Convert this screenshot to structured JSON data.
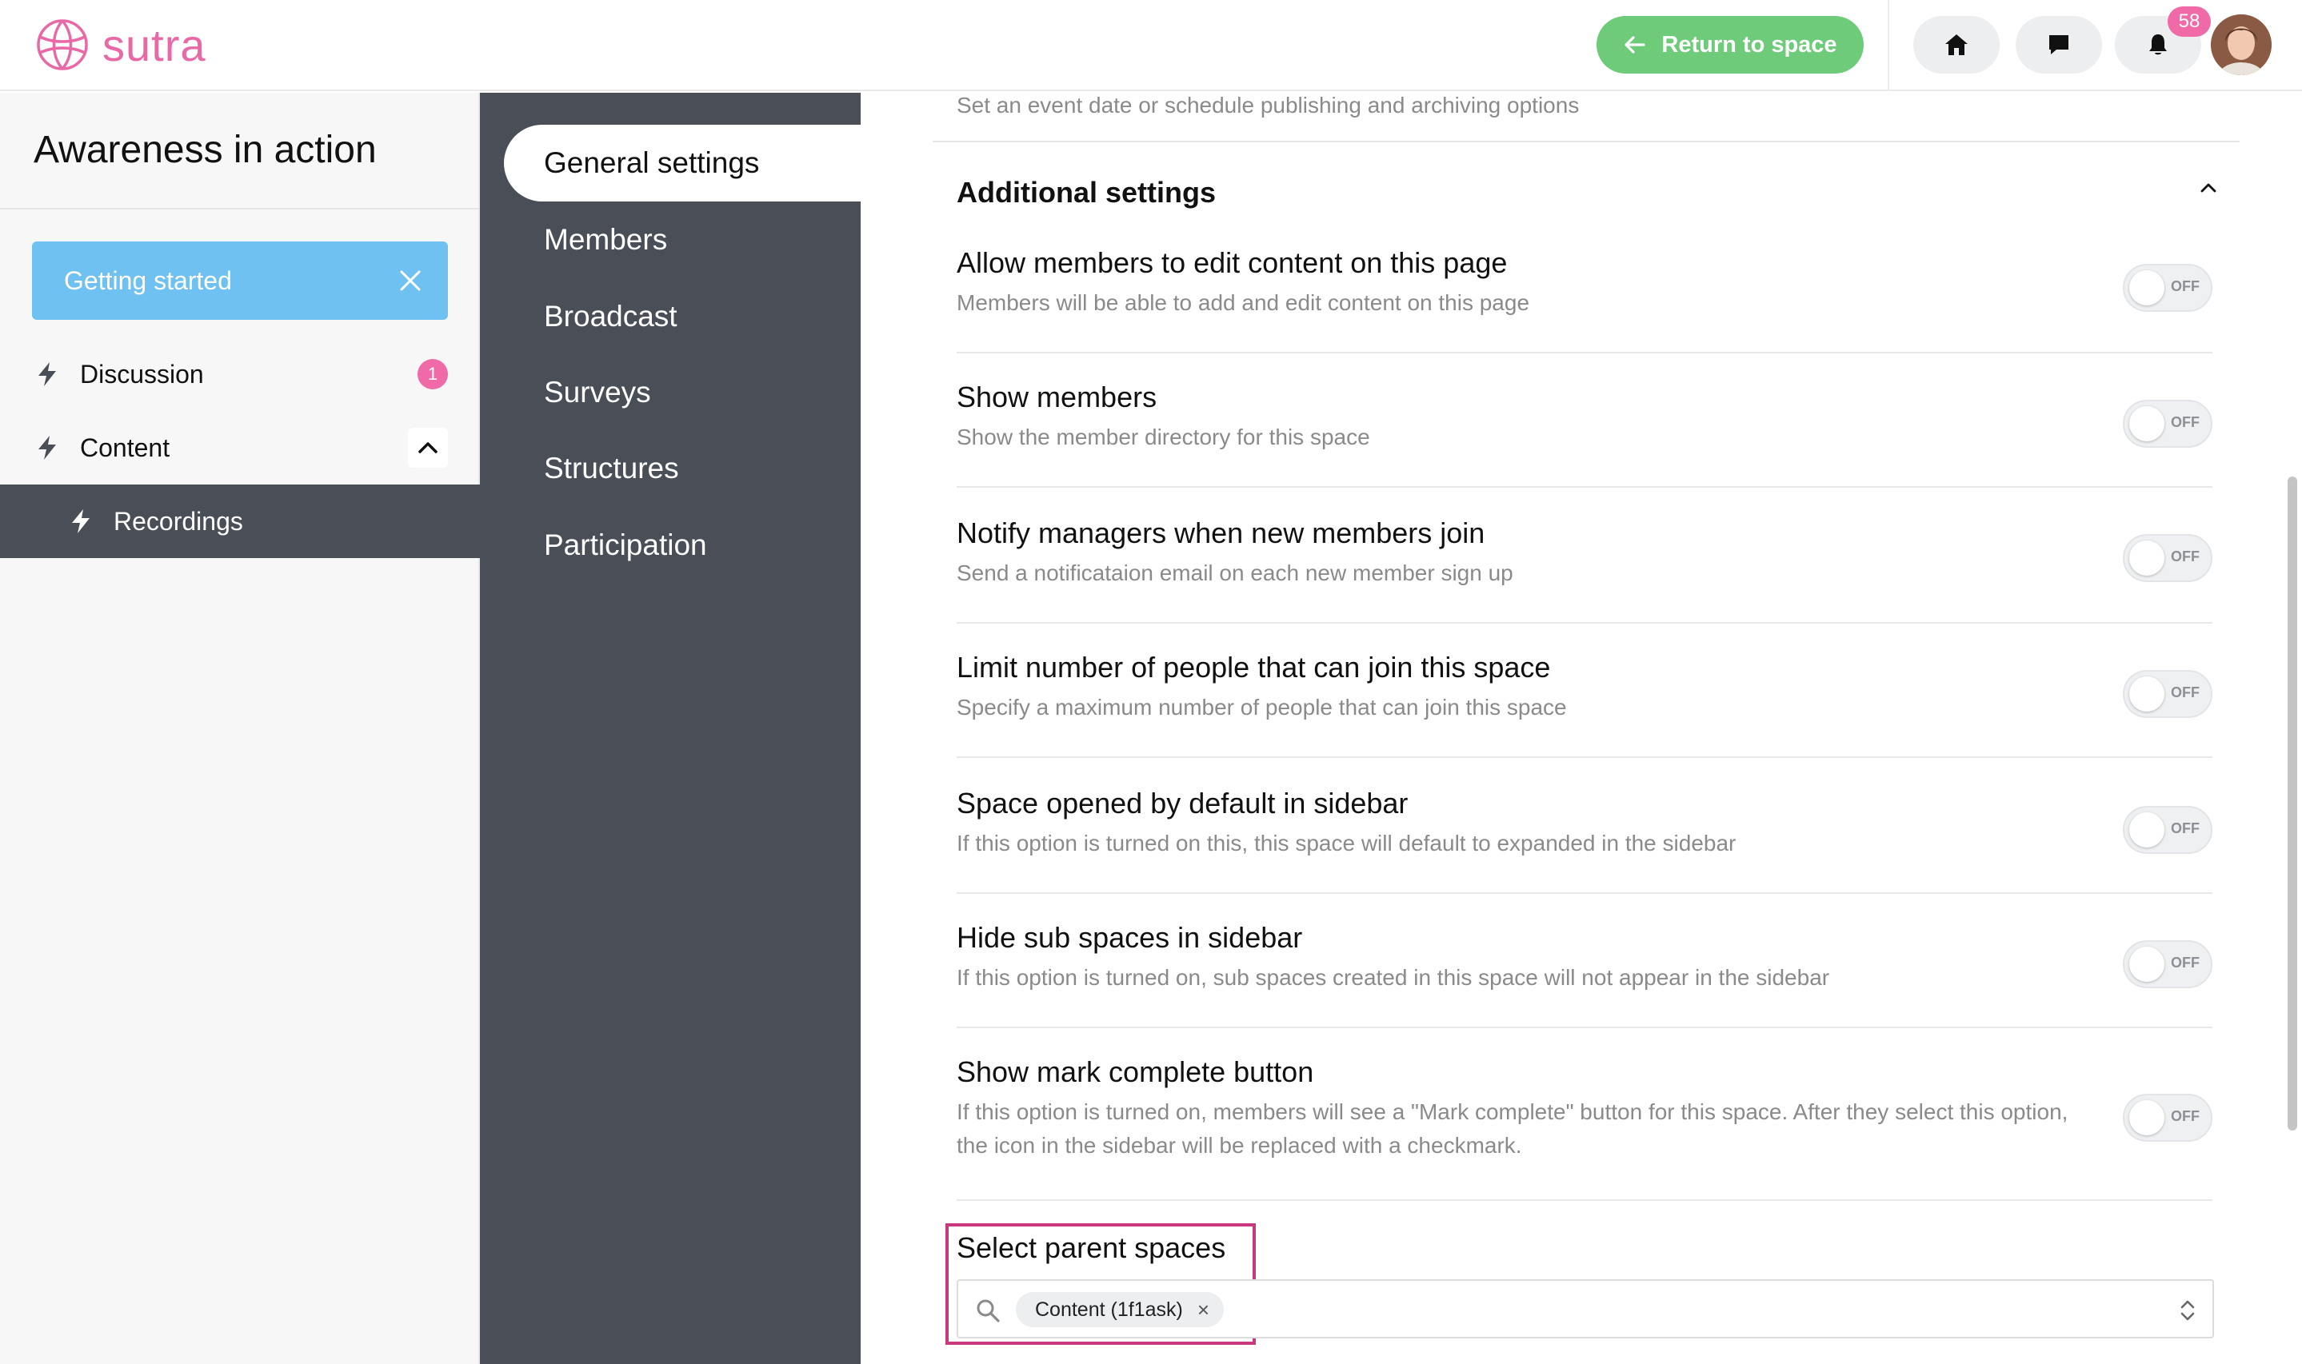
{
  "brand": {
    "name": "sutra",
    "color": "#e968a6"
  },
  "topbar": {
    "return_label": "Return to space",
    "return_color": "#6dcb7a",
    "notification_count": "58",
    "icons": [
      "home-icon",
      "chat-icon",
      "bell-icon"
    ]
  },
  "sidebar": {
    "space_title": "Awareness in action",
    "getting_started": "Getting started",
    "items": [
      {
        "label": "Discussion",
        "badge": "1"
      },
      {
        "label": "Content"
      },
      {
        "label": "Recordings"
      }
    ]
  },
  "settings_nav": {
    "items": [
      {
        "label": "General settings"
      },
      {
        "label": "Members"
      },
      {
        "label": "Broadcast"
      },
      {
        "label": "Surveys"
      },
      {
        "label": "Structures"
      },
      {
        "label": "Participation"
      }
    ]
  },
  "main": {
    "prev_desc": "Set an event date or schedule publishing and archiving options",
    "section_title": "Additional settings",
    "toggle_off_text": "OFF",
    "settings": [
      {
        "title": "Allow members to edit content on this page",
        "desc": "Members will be able to add and edit content on this page",
        "on": false
      },
      {
        "title": "Show members",
        "desc": "Show the member directory for this space",
        "on": false
      },
      {
        "title": "Notify managers when new members join",
        "desc": "Send a notificataion email on each new member sign up",
        "on": false
      },
      {
        "title": "Limit number of people that can join this space",
        "desc": "Specify a maximum number of people that can join this space",
        "on": false
      },
      {
        "title": "Space opened by default in sidebar",
        "desc": "If this option is turned on this, this space will default to expanded in the sidebar",
        "on": false
      },
      {
        "title": "Hide sub spaces in sidebar",
        "desc": "If this option is turned on, sub spaces created in this space will not appear in the sidebar",
        "on": false
      },
      {
        "title": "Show mark complete button",
        "desc": "If this option is turned on, members will see a \"Mark complete\" button for this space. After they select this option, the icon in the sidebar will be replaced with a checkmark.",
        "on": false
      }
    ],
    "parent_spaces_label": "Select parent spaces",
    "parent_spaces_chip": "Content (1f1ask)",
    "chip_remove": "×"
  }
}
